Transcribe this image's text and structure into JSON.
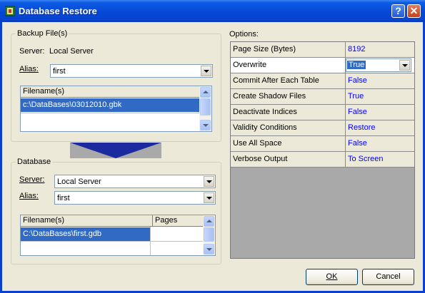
{
  "window": {
    "title": "Database Restore",
    "help_glyph": "?",
    "close_glyph": "✕"
  },
  "backup": {
    "group_label": "Backup File(s)",
    "server_label": "Server:",
    "server_value": "Local Server",
    "alias_label": "Alias:",
    "alias_value": "first",
    "grid_header": "Filename(s)",
    "files": [
      "c:\\DataBases\\03012010.gbk"
    ]
  },
  "database": {
    "group_label": "Database",
    "server_label": "Server:",
    "server_value": "Local Server",
    "alias_label": "Alias:",
    "alias_value": "first",
    "col_filename": "Filename(s)",
    "col_pages": "Pages",
    "files": [
      "C:\\DataBases\\first.gdb"
    ]
  },
  "options": {
    "label": "Options:",
    "rows": [
      {
        "name": "Page Size (Bytes)",
        "value": "8192"
      },
      {
        "name": "Overwrite",
        "value": "True"
      },
      {
        "name": "Commit After Each Table",
        "value": "False"
      },
      {
        "name": "Create Shadow Files",
        "value": "True"
      },
      {
        "name": "Deactivate Indices",
        "value": "False"
      },
      {
        "name": "Validity Conditions",
        "value": "Restore"
      },
      {
        "name": "Use All Space",
        "value": "False"
      },
      {
        "name": "Verbose Output",
        "value": "To Screen"
      }
    ]
  },
  "buttons": {
    "ok": "OK",
    "cancel": "Cancel"
  },
  "colors": {
    "selection": "#316ac5",
    "value_text": "#0000ff",
    "titlebar": "#0548d6"
  }
}
